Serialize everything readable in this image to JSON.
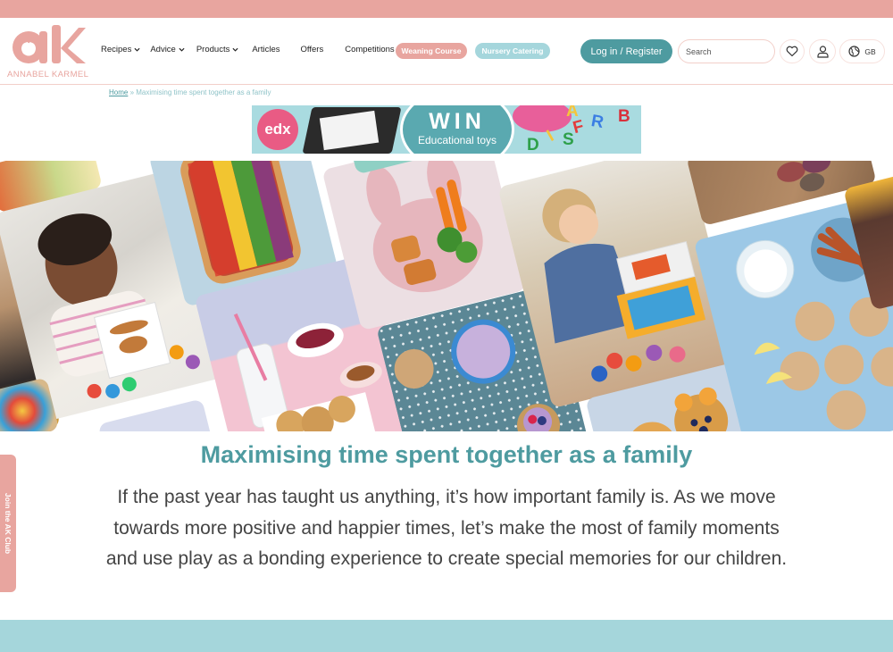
{
  "brand": {
    "name": "ANNABEL KARMEL",
    "logo_mark": "ak",
    "primary_color": "#e8a59f",
    "accent_color": "#4e9ba0",
    "secondary_color": "#a5d6dc"
  },
  "nav": {
    "items": [
      {
        "label": "Recipes",
        "has_dropdown": true
      },
      {
        "label": "Advice",
        "has_dropdown": true
      },
      {
        "label": "Products",
        "has_dropdown": true
      },
      {
        "label": "Articles",
        "has_dropdown": false
      },
      {
        "label": "Offers",
        "has_dropdown": false
      },
      {
        "label": "Competitions",
        "has_dropdown": false
      }
    ],
    "pills": [
      {
        "label": "Weaning Course",
        "color": "#e8a59f"
      },
      {
        "label": "Nursery Catering",
        "color": "#a5d6dc"
      }
    ]
  },
  "header_actions": {
    "login_label": "Log in / Register",
    "search_placeholder": "Search",
    "wishlist_icon": "heart-icon",
    "account_icon": "user-icon",
    "region_icon": "globe-icon",
    "region_label": "GB"
  },
  "breadcrumb": {
    "home": "Home",
    "separator": "»",
    "current": "Maximising time spent together as a family"
  },
  "banner": {
    "brand": "edx",
    "headline": "WIN",
    "subline": "Educational toys",
    "letters": [
      "A",
      "F",
      "R",
      "B",
      "S",
      "D",
      "I"
    ]
  },
  "collage": {
    "tiles": [
      {
        "subject": "girl-playing-with-stacking-stones"
      },
      {
        "subject": "rainbow-vegetable-pizza"
      },
      {
        "subject": "bunny-plate-nuggets-and-veg"
      },
      {
        "subject": "toddler-playing-with-puzzle-cards"
      },
      {
        "subject": "fishcakes-and-sweet-potato-wedges"
      },
      {
        "subject": "milk-and-cookies-snack"
      },
      {
        "subject": "yogurt-and-fruit-tartlets"
      },
      {
        "subject": "bear-muffins"
      }
    ]
  },
  "article": {
    "title": "Maximising time spent together as a family",
    "intro": "If the past year has taught us anything, it’s how important family is. As we move towards more positive and happier times, let’s make the most of family moments and use play as a bonding experience to create special memories for our children."
  },
  "side_tab": {
    "label": "Join the AK Club"
  }
}
